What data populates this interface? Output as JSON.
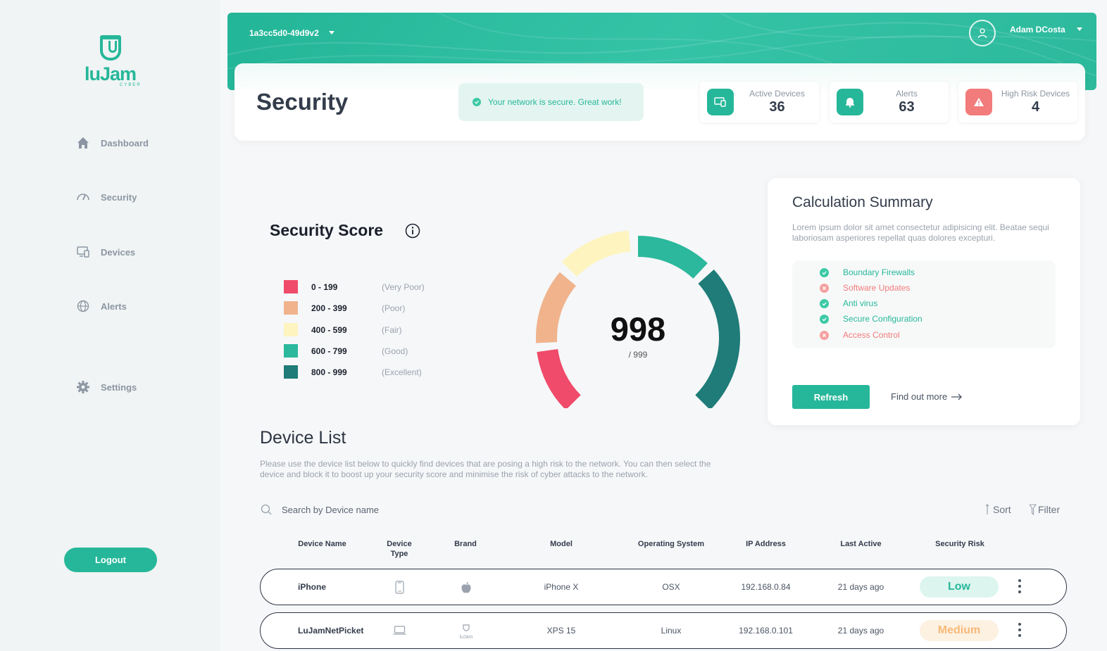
{
  "sidebar": {
    "logo_text": "luJam",
    "logo_sub": "CYBER",
    "items": [
      {
        "label": "Dashboard",
        "icon": "home-icon"
      },
      {
        "label": "Security",
        "icon": "gauge-icon"
      },
      {
        "label": "Devices",
        "icon": "devices-icon"
      },
      {
        "label": "Alerts",
        "icon": "globe-icon"
      },
      {
        "label": "Settings",
        "icon": "gear-icon"
      }
    ],
    "logout_label": "Logout"
  },
  "header": {
    "network_id": "1a3cc5d0-49d9v2",
    "user_name": "Adam DCosta",
    "page_title": "Security",
    "status_message": "Your network is secure. Great work!",
    "stats": [
      {
        "label": "Active Devices",
        "value": "36",
        "icon": "devices-icon",
        "color": "#26b79a"
      },
      {
        "label": "Alerts",
        "value": "63",
        "icon": "bell-icon",
        "color": "#26b79a"
      },
      {
        "label": "High Risk Devices",
        "value": "4",
        "icon": "warning-icon",
        "color": "#f27b7b"
      }
    ]
  },
  "score": {
    "title": "Security Score",
    "value": "998",
    "max_label": "/ 999",
    "legend": [
      {
        "range": "0 - 199",
        "label": "(Very Poor)",
        "color": "#f04b6a"
      },
      {
        "range": "200 - 399",
        "label": "(Poor)",
        "color": "#f0b38c"
      },
      {
        "range": "400 - 599",
        "label": "(Fair)",
        "color": "#fdf4c0"
      },
      {
        "range": "600 - 799",
        "label": "(Good)",
        "color": "#2bb89c"
      },
      {
        "range": "800 - 999",
        "label": "(Excellent)",
        "color": "#1f7c78"
      }
    ]
  },
  "calc": {
    "title": "Calculation Summary",
    "description": "Lorem ipsum dolor sit amet consectetur adipisicing elit. Beatae sequi laboriosam asperiores repellat quas dolores excepturi.",
    "items": [
      {
        "label": "Boundary Firewalls",
        "status": "pass"
      },
      {
        "label": "Software Updates",
        "status": "fail"
      },
      {
        "label": "Anti virus",
        "status": "pass"
      },
      {
        "label": "Secure Configuration",
        "status": "pass"
      },
      {
        "label": "Access Control",
        "status": "fail"
      }
    ],
    "refresh_label": "Refresh",
    "find_more_label": "Find out more"
  },
  "device_list": {
    "title": "Device List",
    "description": "Please use the device list below to quickly find devices that are posing a high risk to the network. You can then select the device and block it to boost up your security score and minimise the risk of cyber attacks to the network.",
    "search_placeholder": "Search by Device name",
    "sort_label": "Sort",
    "filter_label": "Filter",
    "columns": [
      "Device Name",
      "Device Type",
      "Brand",
      "Model",
      "Operating System",
      "IP Address",
      "Last Active",
      "Security Risk"
    ],
    "rows": [
      {
        "name": "iPhone",
        "type_icon": "phone-icon",
        "brand_icon": "apple-icon",
        "model": "iPhone X",
        "os": "OSX",
        "ip": "192.168.0.84",
        "last_active": "21 days ago",
        "risk": "Low",
        "risk_color": "#26b79a",
        "risk_bg": "#dcf5ee"
      },
      {
        "name": "LuJamNetPicket",
        "type_icon": "laptop-icon",
        "brand_icon": "lujam-icon",
        "brand_text": "luJam",
        "model": "XPS 15",
        "os": "Linux",
        "ip": "192.168.0.101",
        "last_active": "21 days ago",
        "risk": "Medium",
        "risk_color": "#f7b977",
        "risk_bg": "#fdf1e2"
      }
    ]
  }
}
